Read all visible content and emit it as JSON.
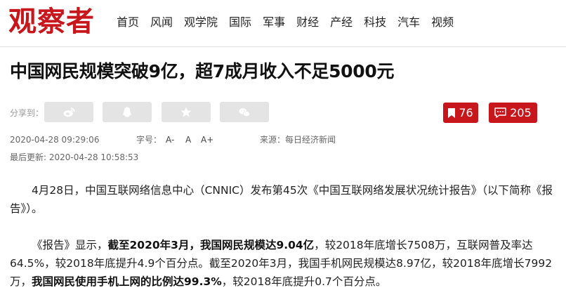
{
  "site": {
    "logo": "观察者",
    "nav": [
      "首页",
      "风闻",
      "观学院",
      "国际",
      "军事",
      "财经",
      "产经",
      "科技",
      "汽车",
      "视频"
    ]
  },
  "article": {
    "title": "中国网民规模突破9亿，超7成月收入不足5000元",
    "share_label": "分享到：",
    "share_buttons": [
      "weibo-icon",
      "qq-icon",
      "star-icon",
      "wechat-icon"
    ],
    "bookmark_count": "76",
    "comment_count": "205",
    "publish_time": "2020-04-28 09:29:06",
    "font_size_label": "字号：",
    "font_size_options": [
      "A-",
      "A",
      "A+"
    ],
    "source": "来源：每日经济新闻",
    "last_updated": "最后更新: 2020-04-28 10:58:53",
    "paragraph1": "4月28日，中国互联网络信息中心（CNNIC）发布第45次《中国互联网络发展状况统计报告》（以下简称《报告》）。",
    "paragraph2": {
      "p1": "《报告》显示，",
      "b1": "截至2020年3月，我国网民规模达9.04亿",
      "p2": "，较2018年底增长7508万，互联网普及率达64.5%，较2018年底提升4.9个百分点。截至2020年3月，我国手机网民规模达8.97亿，较2018年底增长7992万，",
      "b2": "我国网民使用手机上网的比例达99.3%",
      "p3": "，较2018年底提升0.7个百分点。"
    }
  },
  "colors": {
    "brand_red": "#c8161d",
    "share_gray": "#e4e4e4"
  }
}
